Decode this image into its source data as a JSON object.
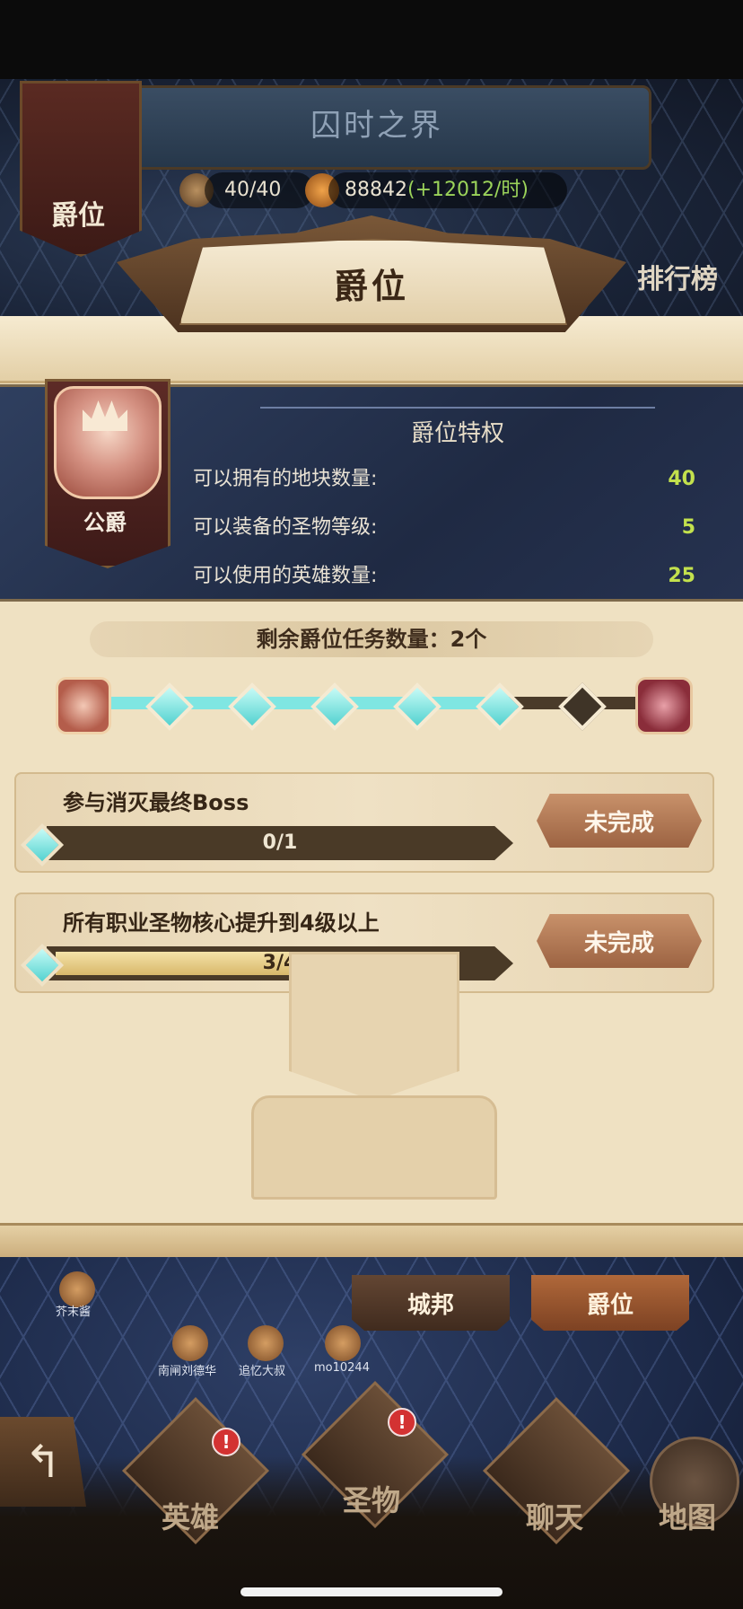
{
  "header": {
    "zone_title": "囚时之界",
    "side_banner_label": "爵位",
    "ranking_label": "排行榜",
    "resources": [
      {
        "icon": "land-icon",
        "value": "40/40"
      },
      {
        "icon": "coin-icon",
        "value": "88842",
        "rate": "(+12012/时)"
      }
    ]
  },
  "panel": {
    "title": "爵位",
    "privileges": {
      "heading": "爵位特权",
      "badge_label": "公爵",
      "rows": [
        {
          "label": "可以拥有的地块数量:",
          "value": "40"
        },
        {
          "label": "可以装备的圣物等级:",
          "value": "5"
        },
        {
          "label": "可以使用的英雄数量:",
          "value": "25"
        }
      ]
    },
    "remaining_tasks": "剩余爵位任务数量：2个",
    "progress": {
      "completed_nodes": 5,
      "total_nodes": 6
    },
    "tasks": [
      {
        "title": "参与消灭最终Boss",
        "progress_text": "0/1",
        "progress": 0.0,
        "status": "未完成"
      },
      {
        "title": "所有职业圣物核心提升到4级以上",
        "progress_text": "3/4",
        "progress": 0.75,
        "status": "未完成"
      }
    ]
  },
  "tabs": {
    "city": "城邦",
    "rank": "爵位"
  },
  "map_names": [
    "芥末酱",
    "南闸刘德华",
    "追忆大叔",
    "mo10244"
  ],
  "nav": {
    "heroes": "英雄",
    "artifacts": "圣物",
    "chat": "聊天",
    "map": "地图",
    "alert_mark": "!",
    "back_icon": "↰"
  },
  "colors": {
    "accent_value": "#c3e14d",
    "progress_cyan": "#7fe6e2",
    "alert": "#d33232"
  }
}
